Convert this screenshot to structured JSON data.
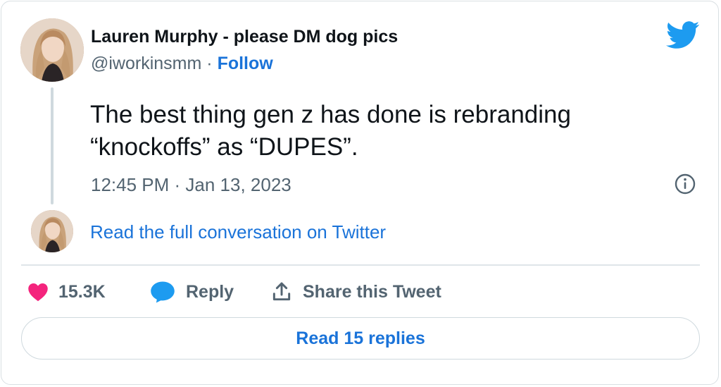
{
  "author": {
    "name": "Lauren Murphy - please DM dog pics",
    "handle": "@iworkinsmm",
    "separator": "·",
    "follow_label": "Follow"
  },
  "tweet": {
    "text_line1": "The best thing gen z has done is rebranding",
    "text_line2": "“knockoffs” as “DUPES”.",
    "timestamp": "12:45 PM · Jan 13, 2023"
  },
  "conversation_link": "Read the full conversation on Twitter",
  "actions": {
    "likes": "15.3K",
    "reply_label": "Reply",
    "share_label": "Share this Tweet"
  },
  "read_replies_label": "Read 15 replies",
  "colors": {
    "link": "#1a73d9",
    "twitter_blue": "#1d9bf0",
    "like_pink": "#f4247d",
    "muted": "#536471"
  },
  "icons": [
    "twitter-bird-icon",
    "info-icon",
    "heart-icon",
    "reply-bubble-icon",
    "share-upload-icon"
  ]
}
